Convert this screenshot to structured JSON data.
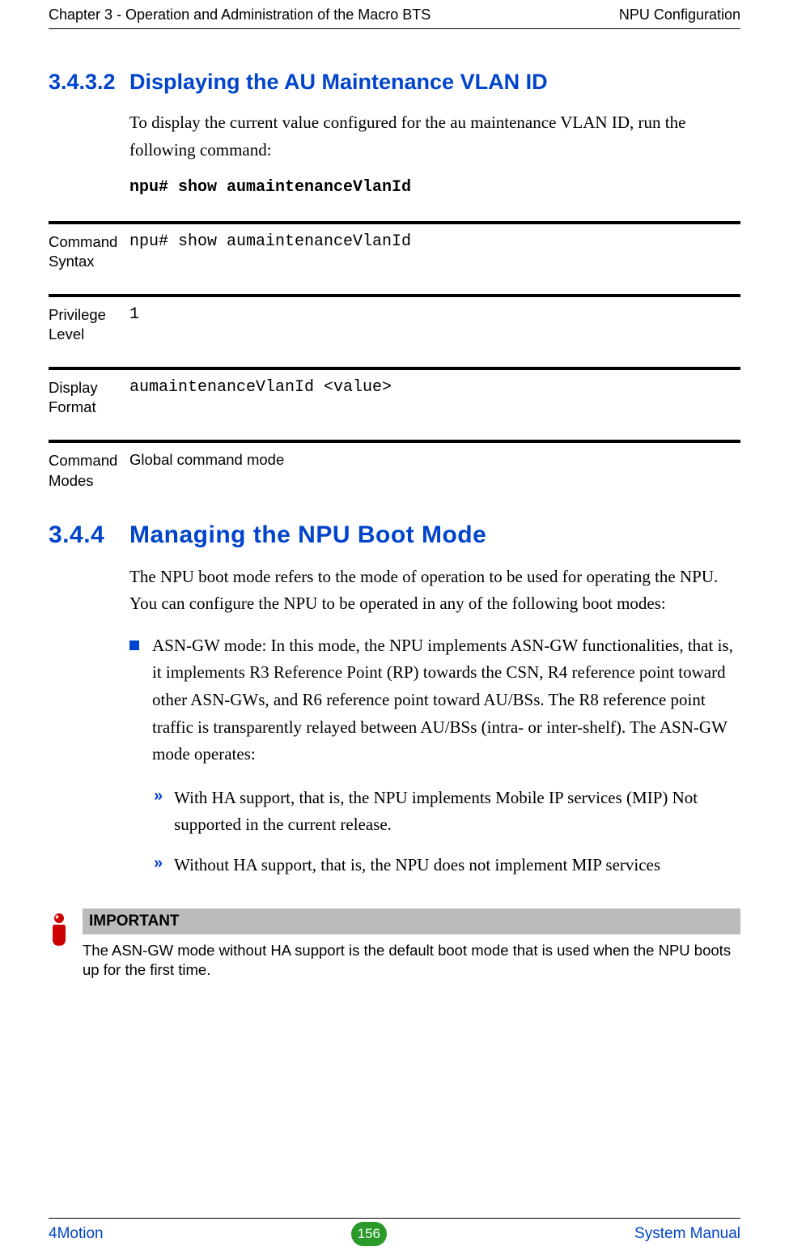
{
  "header": {
    "left": "Chapter 3 - Operation and Administration of the Macro BTS",
    "right": "NPU Configuration"
  },
  "section1": {
    "num": "3.4.3.2",
    "title": "Displaying the AU Maintenance VLAN ID",
    "intro": "To display the current value configured for the au maintenance VLAN ID, run the following command:",
    "cmd": "npu# show aumaintenanceVlanId"
  },
  "params": [
    {
      "label": "Command Syntax",
      "value": "npu# show aumaintenanceVlanId",
      "mono": true
    },
    {
      "label": "Privilege Level",
      "value": "1",
      "mono": true
    },
    {
      "label": "Display Format",
      "value": "aumaintenanceVlanId <value>",
      "mono": true
    },
    {
      "label": "Command Modes",
      "value": "Global command mode",
      "mono": false
    }
  ],
  "section2": {
    "num": "3.4.4",
    "title": "Managing the NPU Boot Mode",
    "intro": "The NPU boot mode refers to the mode of operation to be used for operating the NPU. You can configure the NPU to be operated in any of the following boot modes:",
    "bullet1": "ASN-GW mode: In this mode, the NPU implements ASN-GW functionalities, that is, it implements R3 Reference Point (RP) towards the CSN, R4 reference point toward other ASN-GWs, and R6 reference point toward AU/BSs. The R8 reference point traffic is transparently relayed between AU/BSs (intra- or inter-shelf). The ASN-GW mode operates:",
    "sub1": "With HA support, that is, the NPU implements Mobile IP services (MIP) Not supported in the current release.",
    "sub2": "Without HA support, that is, the NPU does not implement MIP services"
  },
  "important": {
    "label": "IMPORTANT",
    "text": "The ASN-GW mode without HA support is the default boot mode that is used when the NPU boots up for the first time."
  },
  "footer": {
    "left": "4Motion",
    "page": "156",
    "right": "System Manual"
  }
}
